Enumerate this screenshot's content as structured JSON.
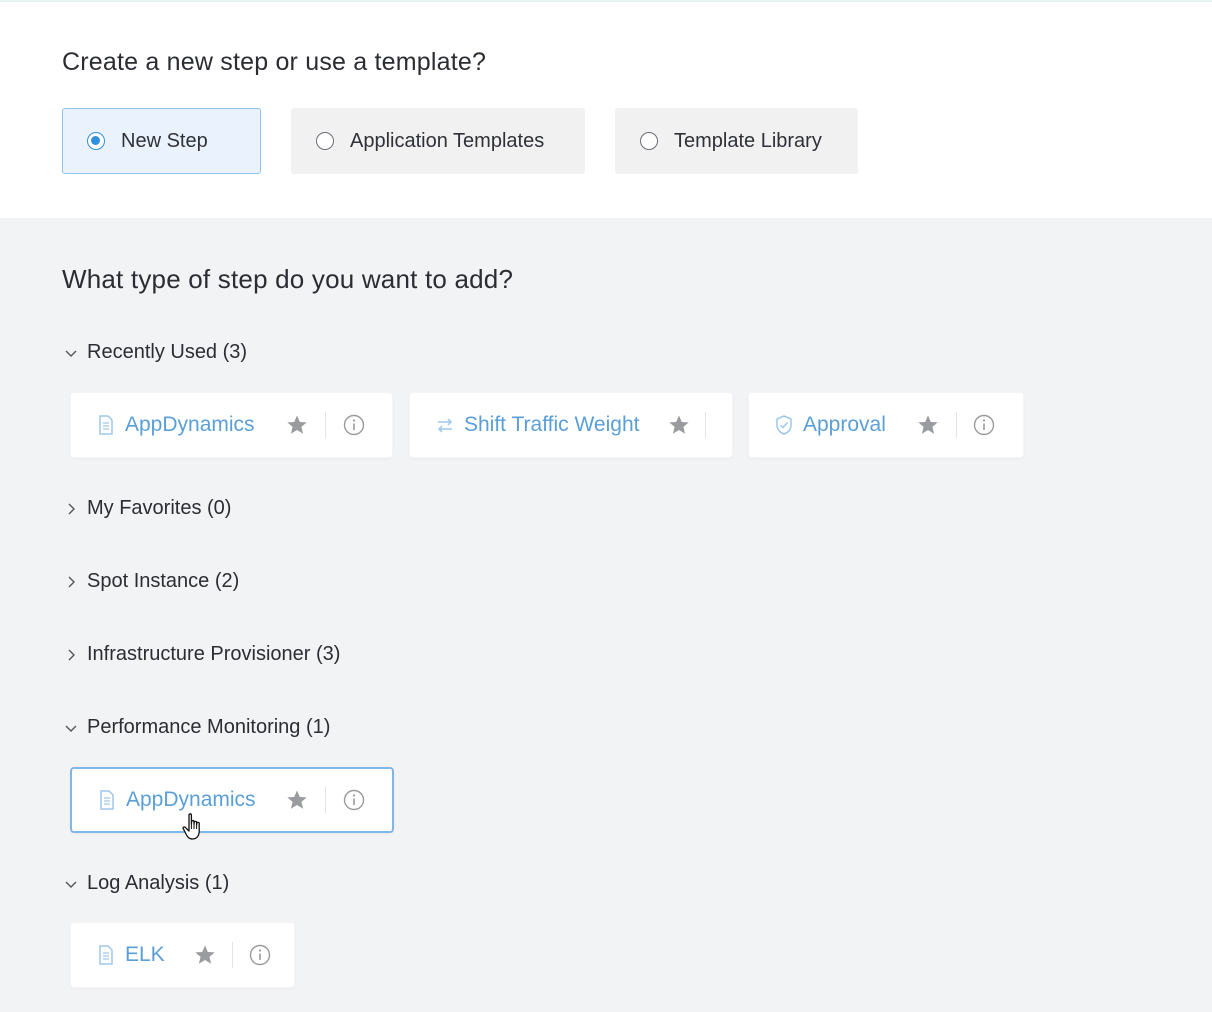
{
  "header": {
    "question": "Create a new step or use a template?",
    "options": [
      {
        "label": "New Step",
        "selected": true
      },
      {
        "label": "Application Templates",
        "selected": false
      },
      {
        "label": "Template Library",
        "selected": false
      }
    ]
  },
  "step_types": {
    "question": "What type of step do you want to add?",
    "sections": [
      {
        "label": "Recently Used (3)",
        "expanded": true,
        "items": [
          {
            "name": "AppDynamics",
            "icon": "document-icon"
          },
          {
            "name": "Shift Traffic Weight",
            "icon": "swap-arrows-icon"
          },
          {
            "name": "Approval",
            "icon": "shield-check-icon"
          }
        ]
      },
      {
        "label": "My Favorites (0)",
        "expanded": false
      },
      {
        "label": "Spot Instance (2)",
        "expanded": false
      },
      {
        "label": "Infrastructure Provisioner (3)",
        "expanded": false
      },
      {
        "label": "Performance Monitoring (1)",
        "expanded": true,
        "items": [
          {
            "name": "AppDynamics",
            "icon": "document-icon"
          }
        ]
      },
      {
        "label": "Log Analysis (1)",
        "expanded": true,
        "items": [
          {
            "name": "ELK",
            "icon": "document-icon"
          }
        ]
      }
    ]
  },
  "colors": {
    "accent": "#2f90e0",
    "link": "#5a9fd8",
    "background": "#f2f3f5"
  }
}
